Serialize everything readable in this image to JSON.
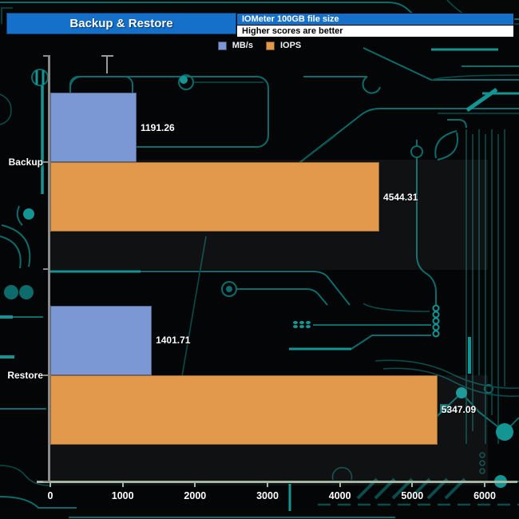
{
  "header": {
    "title": "Backup & Restore",
    "info_line1": "IOMeter 100GB file size",
    "info_line2": "Higher scores are better"
  },
  "legend": {
    "items": [
      {
        "label": "MB/s",
        "color": "#7c98d4"
      },
      {
        "label": "IOPS",
        "color": "#e2994b"
      }
    ]
  },
  "colors": {
    "header_blue": "#1470c9",
    "bar_blue": "#7c98d4",
    "bar_orange": "#e2994b",
    "axis_gray": "#8a8a8a",
    "axis_sage": "#a3b5a3",
    "text_white": "#ffffff",
    "circuit_teal": "#0d6b6b"
  },
  "chart_data": {
    "type": "bar",
    "orientation": "horizontal",
    "title": "Backup & Restore",
    "subtitle": "IOMeter 100GB file size",
    "note": "Higher scores are better",
    "categories": [
      "Backup",
      "Restore"
    ],
    "series": [
      {
        "name": "MB/s",
        "color": "#7c98d4",
        "values": [
          1191.26,
          1401.71
        ]
      },
      {
        "name": "IOPS",
        "color": "#e2994b",
        "values": [
          4544.31,
          5347.09
        ]
      }
    ],
    "value_labels": {
      "MB/s": [
        "1191.26",
        "1401.71"
      ],
      "IOPS": [
        "4544.31",
        "5347.09"
      ]
    },
    "xlabel": "",
    "ylabel": "",
    "xlim": [
      0,
      6000
    ],
    "x_ticks": [
      0,
      1000,
      2000,
      3000,
      4000,
      5000,
      6000
    ],
    "grid": false,
    "legend_position": "top-center"
  }
}
